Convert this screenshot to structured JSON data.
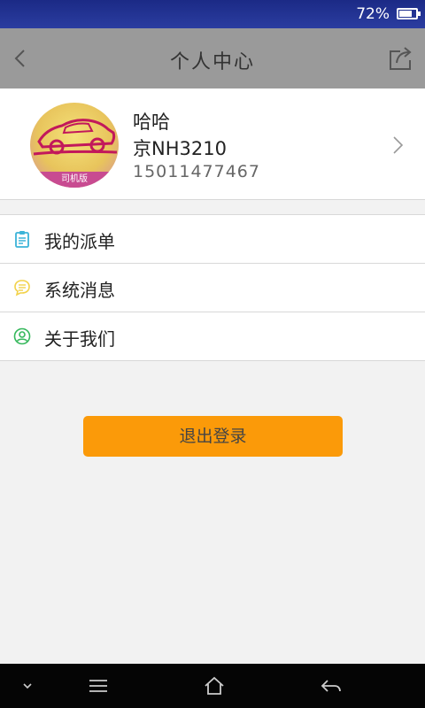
{
  "status_bar": {
    "battery_text": "72%",
    "battery_level": 0.72
  },
  "header": {
    "title": "个人中心",
    "back_icon": "chevron-left-icon",
    "share_icon": "share-icon"
  },
  "profile": {
    "name": "哈哈",
    "plate": "京NH3210",
    "phone": "15011477467",
    "avatar_badge": "司机版"
  },
  "menu": {
    "items": [
      {
        "label": "我的派单",
        "icon": "clipboard-icon",
        "color": "#3bb3d8"
      },
      {
        "label": "系统消息",
        "icon": "message-icon",
        "color": "#f2d24a"
      },
      {
        "label": "关于我们",
        "icon": "user-circle-icon",
        "color": "#36b85c"
      }
    ]
  },
  "logout": {
    "label": "退出登录",
    "color": "#fb9a09"
  },
  "nav_bar": {
    "buttons": [
      "chevron-down-icon",
      "menu-icon",
      "home-icon",
      "back-arrow-icon"
    ]
  }
}
